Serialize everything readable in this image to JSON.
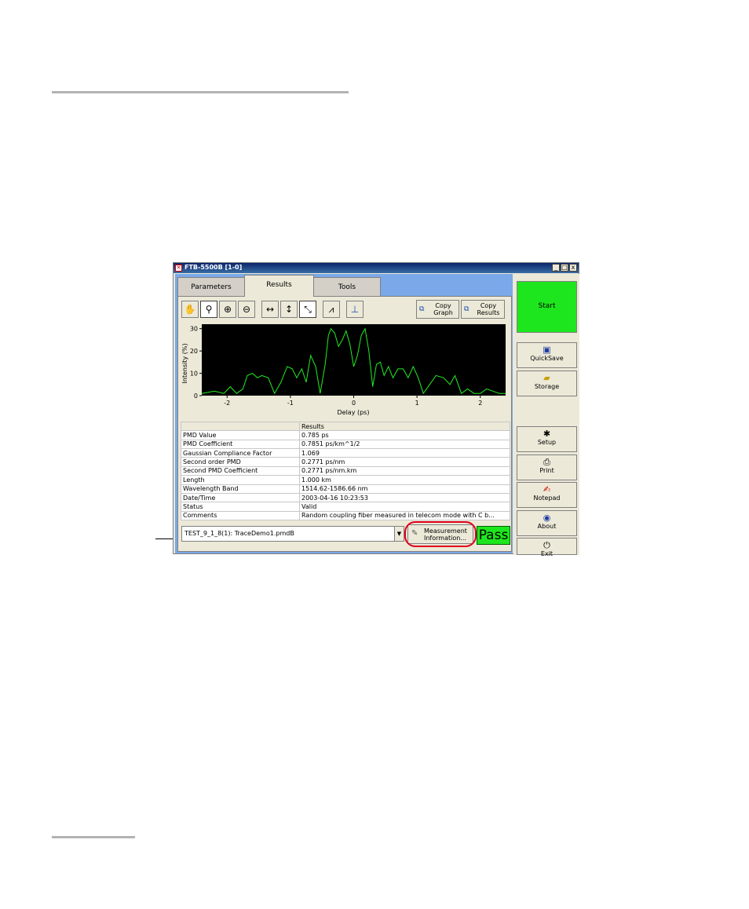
{
  "window": {
    "title": "FTB-5500B [1-0]",
    "controls": [
      "_",
      "□",
      "x"
    ]
  },
  "tabs": [
    {
      "label": "Parameters",
      "active": false
    },
    {
      "label": "Results",
      "active": true
    },
    {
      "label": "Tools",
      "active": false
    }
  ],
  "toolbar": {
    "tools": [
      "hand-icon",
      "zoom-select-icon",
      "zoom-in-icon",
      "zoom-out-icon",
      "zoom-horizontal-icon",
      "zoom-vertical-icon",
      "zoom-both-icon",
      "zoom-peak-icon",
      "marker-icon"
    ],
    "copy_graph": "Copy\nGraph",
    "copy_results": "Copy\nResults"
  },
  "chart_data": {
    "type": "line",
    "xlabel": "Delay (ps)",
    "ylabel": "Intensity (%)",
    "xlim": [
      -2.4,
      2.4
    ],
    "ylim": [
      0,
      32
    ],
    "xticks": [
      -2,
      -1,
      0,
      1,
      2
    ],
    "yticks": [
      0,
      10,
      20,
      30
    ],
    "background": "#000000",
    "line_color": "#22ee22",
    "series": [
      {
        "x": [
          -2.4,
          -2.2,
          -2.05,
          -1.95,
          -1.85,
          -1.75,
          -1.68,
          -1.6,
          -1.52,
          -1.45,
          -1.35,
          -1.25,
          -1.15,
          -1.05,
          -0.97,
          -0.9,
          -0.82,
          -0.75,
          -0.68,
          -0.6,
          -0.53,
          -0.45,
          -0.4,
          -0.36,
          -0.3,
          -0.24,
          -0.18,
          -0.12,
          -0.06,
          0.0,
          0.06,
          0.12,
          0.18,
          0.24,
          0.3,
          0.36,
          0.42,
          0.48,
          0.55,
          0.62,
          0.7,
          0.78,
          0.86,
          0.94,
          1.02,
          1.1,
          1.2,
          1.3,
          1.42,
          1.52,
          1.6,
          1.7,
          1.8,
          1.9,
          2.0,
          2.1,
          2.2,
          2.3,
          2.4
        ],
        "y": [
          1,
          2,
          1,
          4,
          1,
          3,
          9,
          10,
          8,
          9,
          8,
          1,
          6,
          13,
          12,
          8,
          12,
          6,
          18,
          13,
          1,
          14,
          27,
          30,
          28,
          22,
          25,
          29,
          23,
          13,
          18,
          27,
          30,
          20,
          4,
          14,
          15,
          9,
          13,
          8,
          12,
          12,
          8,
          13,
          8,
          1,
          5,
          9,
          8,
          5,
          9,
          1,
          3,
          1,
          1,
          3,
          2,
          1,
          1
        ]
      }
    ]
  },
  "results_table": {
    "header": [
      "",
      "Results"
    ],
    "rows": [
      [
        "PMD Value",
        "0.785 ps"
      ],
      [
        "PMD Coefficient",
        "0.7851 ps/km^1/2"
      ],
      [
        "Gaussian Compliance Factor",
        "1.069"
      ],
      [
        "Second order PMD",
        "0.2771 ps/nm"
      ],
      [
        "Second PMD Coefficient",
        "0.2771 ps/nm.km"
      ],
      [
        "Length",
        "1.000 km"
      ],
      [
        "Wavelength Band",
        "1514.62-1586.66 nm"
      ],
      [
        "Date/Time",
        "2003-04-16 10:23:53"
      ],
      [
        "Status",
        "Valid"
      ],
      [
        "Comments",
        "Random coupling fiber measured in telecom mode with C b..."
      ]
    ]
  },
  "bottom": {
    "file": "TEST_9_1_8(1): TraceDemo1.pmdB",
    "measurement_button": "Measurement\nInformation...",
    "pass_label": "Pass",
    "highlight_color": "#e0001b"
  },
  "side": {
    "start": "Start",
    "buttons": [
      {
        "label": "QuickSave",
        "icon": "floppy-icon"
      },
      {
        "label": "Storage",
        "icon": "folder-icon"
      },
      {
        "label": "Setup",
        "icon": "tools-icon"
      },
      {
        "label": "Print",
        "icon": "printer-icon"
      },
      {
        "label": "Notepad",
        "icon": "notepad-icon"
      },
      {
        "label": "About",
        "icon": "about-icon"
      },
      {
        "label": "Exit",
        "icon": "power-icon"
      }
    ]
  }
}
